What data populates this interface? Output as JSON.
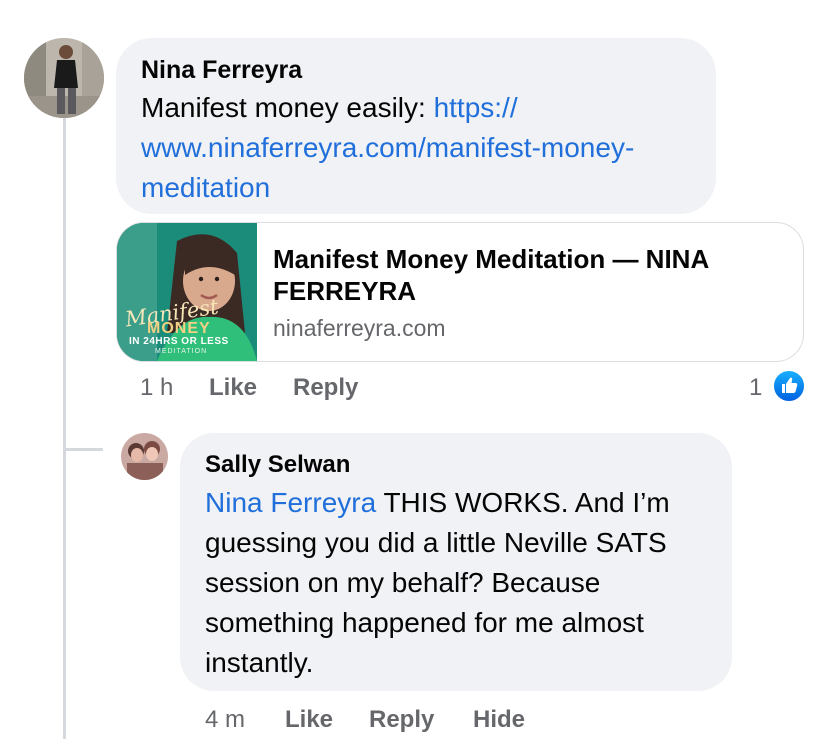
{
  "comment1": {
    "author": "Nina Ferreyra",
    "text_prefix": "Manifest money easily: ",
    "link_line1": "https://",
    "link_line2": "www.ninaferreyra.com/manifest-money-",
    "link_line3": "meditation",
    "preview": {
      "title_line1": "Manifest Money Meditation — NINA",
      "title_line2": "FERREYRA",
      "domain": "ninaferreyra.com",
      "thumb_script": "Manifest",
      "thumb_money": "MONEY",
      "thumb_sub": "IN 24HRS OR LESS",
      "thumb_caption": "MEDITATION"
    },
    "time": "1 h",
    "like_label": "Like",
    "reply_label": "Reply",
    "reaction_count": "1",
    "reaction_icon": "thumbs-up-icon",
    "reaction_color": "#1877f2"
  },
  "reply1": {
    "author": "Sally Selwan",
    "mention": "Nina Ferreyra",
    "line1_rest": " THIS WORKS. And I’m",
    "line2": "guessing you did a little Neville SATS",
    "line3": "session on my behalf?  Because",
    "line4": "something happened for me almost",
    "line5": "instantly.",
    "time": "4 m",
    "like_label": "Like",
    "reply_label": "Reply",
    "hide_label": "Hide"
  },
  "colors": {
    "bubble": "#f0f2f5",
    "link": "#216fdb",
    "meta": "#65676b",
    "thread_line": "#d5d8dd"
  }
}
